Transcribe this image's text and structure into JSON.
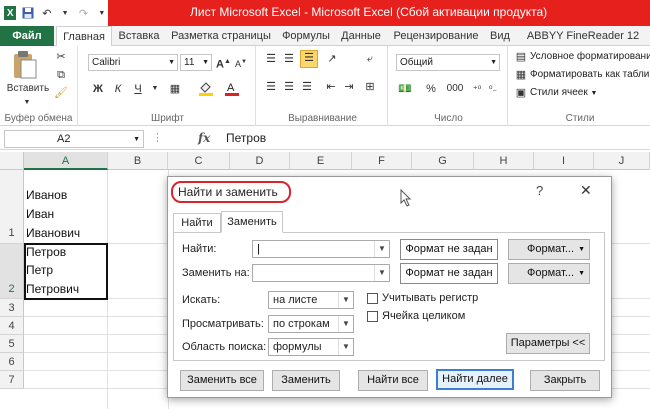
{
  "window": {
    "title": "Лист Microsoft Excel - Microsoft Excel (Сбой активации продукта)"
  },
  "tabs": [
    "Файл",
    "Главная",
    "Вставка",
    "Разметка страницы",
    "Формулы",
    "Данные",
    "Рецензирование",
    "Вид",
    "ABBYY FineReader 12"
  ],
  "ribbon": {
    "paste_label": "Вставить",
    "clipboard_label": "Буфер обмена",
    "font_name": "Calibri",
    "font_size": "11",
    "font_group_label": "Шрифт",
    "bold": "Ж",
    "italic": "К",
    "underline": "Ч",
    "align_group_label": "Выравнивание",
    "number_format": "Общий",
    "number_group_label": "Число",
    "percent": "%",
    "thousands": "000",
    "cond_format": "Условное форматирование",
    "format_table": "Форматировать как таблицу",
    "cell_styles": "Стили ячеек",
    "styles_group_label": "Стили"
  },
  "formula_bar": {
    "cell_ref": "A2",
    "fx": "fx",
    "value": "Петров"
  },
  "grid": {
    "columns": [
      "A",
      "B",
      "C",
      "D",
      "E",
      "F",
      "G",
      "H",
      "I",
      "J"
    ],
    "rows": [
      "1",
      "2",
      "3",
      "4",
      "5",
      "6",
      "7"
    ],
    "cells": [
      "Иванов",
      "Иван",
      "Иванович",
      "Петров",
      "Петр",
      "Петрович"
    ]
  },
  "dialog": {
    "title": "Найти и заменить",
    "help": "?",
    "close": "✕",
    "tab_find": "Найти",
    "tab_replace": "Заменить",
    "find_label": "Найти:",
    "replace_label": "Заменить на:",
    "find_value": "",
    "replace_value": "",
    "format_not_set_1": "Формат не задан",
    "format_not_set_2": "Формат не задан",
    "format_btn_1": "Формат...",
    "format_btn_2": "Формат...",
    "search_label": "Искать:",
    "search_value": "на листе",
    "look_label": "Просматривать:",
    "look_value": "по строкам",
    "area_label": "Область поиска:",
    "area_value": "формулы",
    "match_case": "Учитывать регистр",
    "whole_cell": "Ячейка целиком",
    "params_btn": "Параметры <<",
    "replace_all_btn": "Заменить все",
    "replace_btn": "Заменить",
    "find_all_btn": "Найти все",
    "find_next_btn": "Найти далее",
    "close_btn": "Закрыть"
  },
  "colors": {
    "title_bar": "#e6201c",
    "file_tab": "#217346",
    "highlight_ring": "#d9252a"
  }
}
